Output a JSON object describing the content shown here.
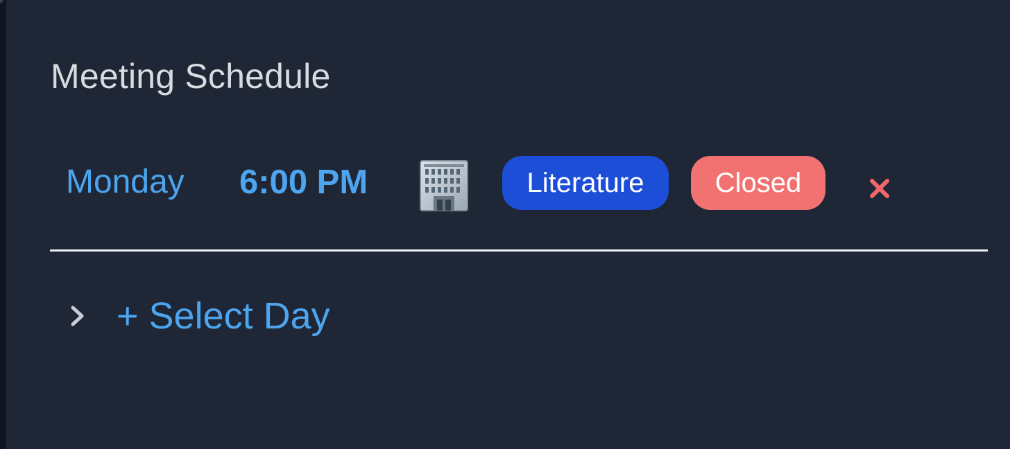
{
  "panel": {
    "title": "Meeting Schedule"
  },
  "meeting": {
    "day": "Monday",
    "time": "6:00 PM",
    "location_icon": "office-building-icon",
    "tags": [
      {
        "label": "Literature",
        "color": "#1d4ed8"
      },
      {
        "label": "Closed",
        "color": "#f27271"
      }
    ],
    "remove_icon": "close-icon",
    "remove_color": "#f06868"
  },
  "add_day": {
    "label": "+ Select Day",
    "icon": "chevron-right-icon"
  },
  "colors": {
    "background": "#1f2736",
    "accent": "#4ca5ee",
    "title_text": "#d8dbe0",
    "divider": "#f0f1f3"
  }
}
